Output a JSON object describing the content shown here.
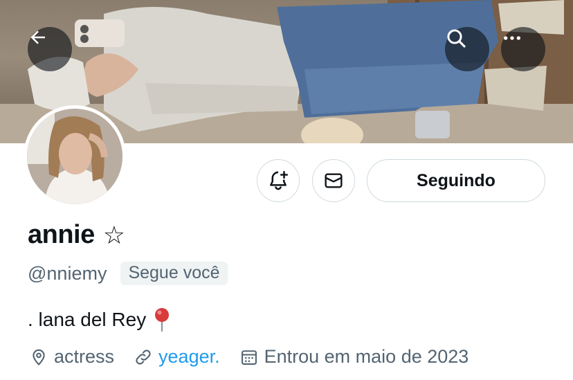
{
  "header": {
    "back_icon": "arrow-left-icon",
    "search_icon": "search-icon",
    "more_icon": "more-horizontal-icon"
  },
  "actions": {
    "notify_icon": "bell-plus-icon",
    "message_icon": "envelope-icon",
    "follow_label": "Seguindo"
  },
  "profile": {
    "display_name": "annie",
    "name_emoji": "☆",
    "handle": "@nniemy",
    "follows_you": "Segue você",
    "bio": ". lana del Rey",
    "bio_emoji": "📍",
    "location": "actress",
    "website": "yeager.",
    "joined": "Entrou em maio de 2023"
  },
  "colors": {
    "link": "#1d9bf0",
    "secondary_text": "#536471",
    "border": "#cfd9de",
    "badge_bg": "#eff3f4"
  }
}
